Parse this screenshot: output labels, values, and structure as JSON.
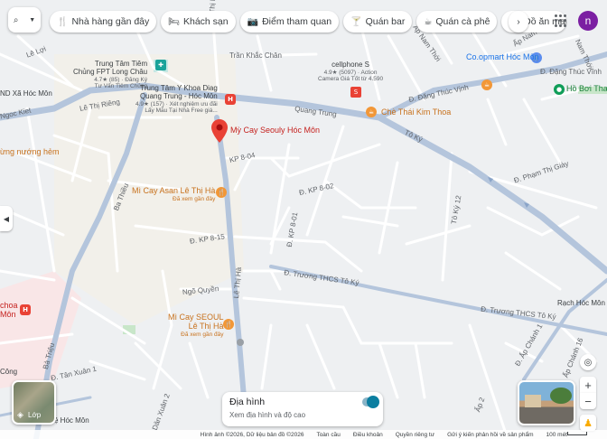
{
  "colors": {
    "background": "#eef0f2",
    "road_major": "#b4c5dc",
    "road_minor": "#ffffff",
    "pin_red": "#e94235",
    "pin_orange": "#f29737",
    "pin_green": "#0f9d58",
    "avatar": "#7b1fa2"
  },
  "search": {
    "icon": "search-icon"
  },
  "categories": [
    {
      "icon": "fork-knife-icon",
      "glyph": "🍴",
      "label": "Nhà hàng gần đây"
    },
    {
      "icon": "bed-icon",
      "glyph": "🛏",
      "label": "Khách sạn"
    },
    {
      "icon": "camera-icon",
      "glyph": "📷",
      "label": "Điểm tham quan"
    },
    {
      "icon": "cocktail-icon",
      "glyph": "🍸",
      "label": "Quán bar"
    },
    {
      "icon": "coffee-icon",
      "glyph": "☕",
      "label": "Quán cà phê"
    },
    {
      "icon": "bag-icon",
      "glyph": "🛍",
      "label": "Đồ ăn mang"
    }
  ],
  "user": {
    "initial": "n"
  },
  "roads": {
    "r1": "Bùi Thị Ho",
    "r2": "Trần Khắc Chân",
    "r3": "Lê Lợi",
    "r4": "Lê Thị Riêng",
    "r5": "KP 8-04",
    "r6": "Ba Thiều",
    "r7": "Tô Ký",
    "r8": "Đ. Phạm Thị Giày",
    "r9": "Đ. KP 8-02",
    "r10": "Đ. KP 8-01",
    "r11": "Đ. KP 8-15",
    "r12": "Đ. Trương THCS Tô Ký",
    "r13": "Đ. Trương THCS Tô Ký",
    "r14": "Ngõ Quyền",
    "r15": "Lê Thị Hà",
    "r16": "Bà Triệu",
    "r17": "Đ. Tân Xuân 1",
    "r18": "Đ. Đặng Thúc Vịnh",
    "r19": "Đ. Đặng Thúc Vĩnh",
    "r20": "Ấp Nam Thới",
    "r21": "Nam Thới",
    "r22": "Đ. Ấp Chánh 1",
    "r23": "Ấp Chánh 16",
    "r24": "Quang Trung",
    "r25": "Dân Xuân 2",
    "r26": "Ấp 2",
    "r27": "Ấp Nam Thới",
    "r28": "Tô Ký 12",
    "r29": "Ngoc Kiet"
  },
  "places": {
    "p1": {
      "title": "Trung Tâm Tiêm",
      "line2": "Chủng FPT Long Châu",
      "line3": "4.7★ (85) · Đăng Ký",
      "line4": "Tư Vấn Tiêm Chủng"
    },
    "p2": {
      "title": "Trung Tâm Y Khoa Diag",
      "line2": "Quang Trung - Hóc Môn",
      "line3": "4.9★ (157) · Xét nghiệm ưu đãi",
      "line4": "Lấy Mẫu Tại Nhà Free giá..."
    },
    "p3": {
      "title": "cellphone S",
      "line2": "4.9★ (5097) · Action",
      "line3": "Camera Giá Tốt từ 4.590"
    },
    "p4": {
      "title": "Co.opmart Hóc Môn"
    },
    "p5": {
      "title": "Hồ Bơi Tha"
    },
    "p6": {
      "title": "Chè Thái Kim Thoa"
    },
    "p7": {
      "title": "Mỳ Cay Seouly Hóc Môn"
    },
    "p8": {
      "title": "Mì Cay Asan Lê Thị Hà",
      "sub": "Đã xem gần đây"
    },
    "p9": {
      "title": "Mì Cay SEOUL",
      "line2": "Lê Thị Hà",
      "sub": "Đã xem gần đây"
    },
    "p10": {
      "title": "Rạch Hóc Môn"
    },
    "p11": {
      "title": "ND Xã Hóc Môn"
    },
    "p12": {
      "title": "ừng nướng hẻm"
    },
    "p13": {
      "title": "choa",
      "line2": "Môn"
    },
    "p14": {
      "title": "Công"
    },
    "p15": {
      "title": "ệ Hóc Môn"
    }
  },
  "layers": {
    "label": "Lớp"
  },
  "terrain": {
    "title": "Địa hình",
    "subtitle": "Xem địa hình và độ cao",
    "enabled": true
  },
  "footer": {
    "imagery": "Hình ảnh ©2026, Dữ liệu bản đồ ©2026",
    "global": "Toàn cầu",
    "terms": "Điều khoản",
    "privacy": "Quyền riêng tư",
    "feedback": "Gửi ý kiến phản hồi về sản phẩm",
    "scale": "100 mét"
  }
}
